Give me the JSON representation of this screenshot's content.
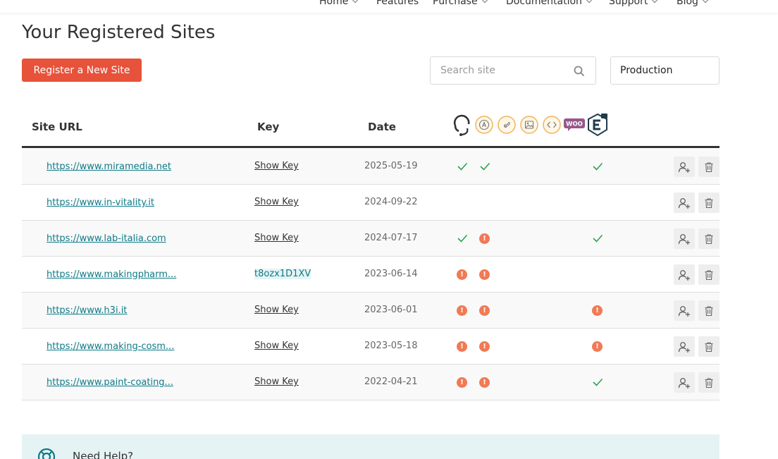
{
  "nav": {
    "items": [
      {
        "label": "Home",
        "dropdown": true
      },
      {
        "label": "Features",
        "dropdown": false
      },
      {
        "label": "Purchase",
        "dropdown": true
      },
      {
        "label": "Documentation",
        "dropdown": true
      },
      {
        "label": "Support",
        "dropdown": true
      },
      {
        "label": "Blog",
        "dropdown": true
      }
    ]
  },
  "page": {
    "title": "Your Registered Sites",
    "register_label": "Register a New Site",
    "search_placeholder": "Search site",
    "environment": "Production"
  },
  "table": {
    "headers": {
      "url": "Site URL",
      "key": "Key",
      "date": "Date"
    },
    "feature_icons": [
      "support-icon",
      "accessibility-icon",
      "link-icon",
      "image-icon",
      "code-icon",
      "woocommerce-icon",
      "elementor-icon"
    ],
    "rows": [
      {
        "url": "https://www.miramedia.net",
        "key": "Show Key",
        "key_revealed": false,
        "date": "2025-05-19",
        "status": [
          "check",
          "check",
          "check"
        ]
      },
      {
        "url": "https://www.in-vitality.it",
        "key": "Show Key",
        "key_revealed": false,
        "date": "2024-09-22",
        "status": [
          "none",
          "none",
          "none"
        ]
      },
      {
        "url": "https://www.lab-italia.com",
        "key": "Show Key",
        "key_revealed": false,
        "date": "2024-07-17",
        "status": [
          "check",
          "warn",
          "check"
        ]
      },
      {
        "url": "https://www.makingpharm...",
        "key": "t8ozx1D1XV",
        "key_revealed": true,
        "date": "2023-06-14",
        "status": [
          "warn",
          "warn",
          "none"
        ]
      },
      {
        "url": "https://www.h3i.it",
        "key": "Show Key",
        "key_revealed": false,
        "date": "2023-06-01",
        "status": [
          "warn",
          "warn",
          "warn"
        ]
      },
      {
        "url": "https://www.making-cosm...",
        "key": "Show Key",
        "key_revealed": false,
        "date": "2023-05-18",
        "status": [
          "warn",
          "warn",
          "warn"
        ]
      },
      {
        "url": "https://www.paint-coating...",
        "key": "Show Key",
        "key_revealed": false,
        "date": "2022-04-21",
        "status": [
          "warn",
          "warn",
          "check"
        ]
      }
    ],
    "row_actions": [
      "add-user-icon",
      "trash-icon"
    ]
  },
  "help": {
    "title": "Need Help?"
  },
  "colors": {
    "accent": "#e7523a",
    "link": "#0e7a86",
    "check": "#2aa350",
    "warn": "#f07a55",
    "woo": "#96588a",
    "icon_ring": "#f0b45a"
  }
}
